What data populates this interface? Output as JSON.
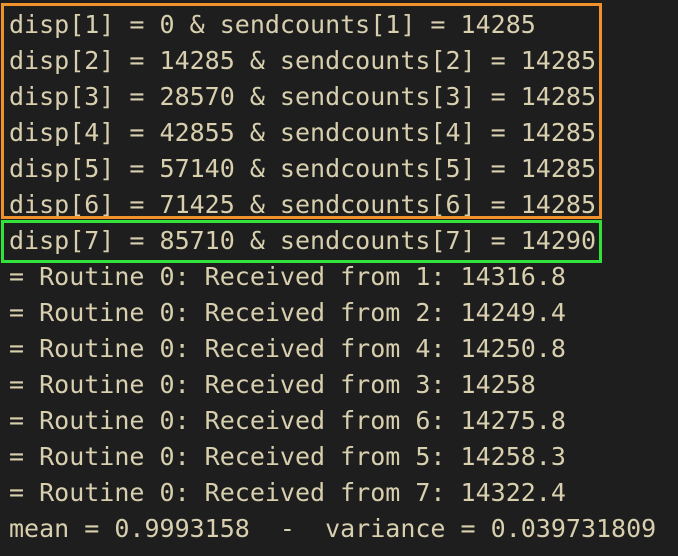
{
  "terminal": {
    "lines": [
      "disp[1] = 0 & sendcounts[1] = 14285",
      "disp[2] = 14285 & sendcounts[2] = 14285",
      "disp[3] = 28570 & sendcounts[3] = 14285",
      "disp[4] = 42855 & sendcounts[4] = 14285",
      "disp[5] = 57140 & sendcounts[5] = 14285",
      "disp[6] = 71425 & sendcounts[6] = 14285",
      "disp[7] = 85710 & sendcounts[7] = 14290",
      "= Routine 0: Received from 1: 14316.8",
      "= Routine 0: Received from 2: 14249.4",
      "= Routine 0: Received from 4: 14250.8",
      "= Routine 0: Received from 3: 14258",
      "= Routine 0: Received from 6: 14275.8",
      "= Routine 0: Received from 5: 14258.3",
      "= Routine 0: Received from 7: 14322.4",
      "mean = 0.9993158  -  variance = 0.039731809"
    ]
  },
  "colors": {
    "background": "#1e1e1e",
    "text": "#d8cfae",
    "highlight_orange": "#f0922b",
    "highlight_green": "#32e23b"
  }
}
